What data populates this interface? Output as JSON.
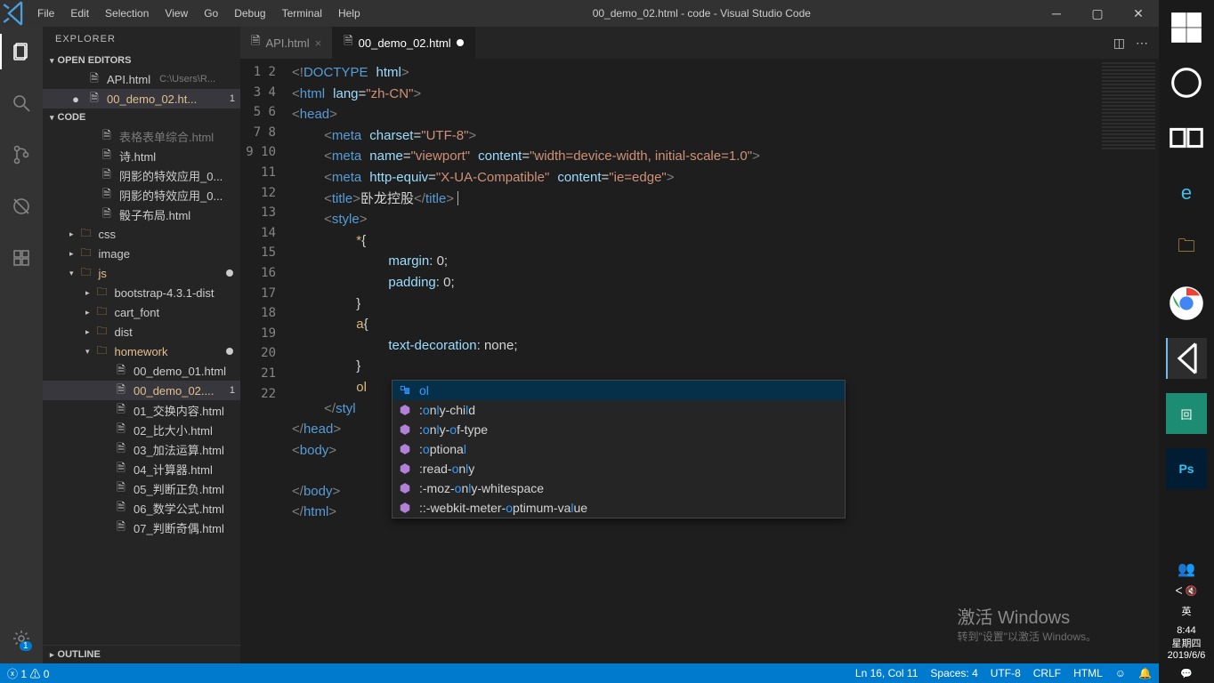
{
  "titlebar": {
    "menu": [
      "File",
      "Edit",
      "Selection",
      "View",
      "Go",
      "Debug",
      "Terminal",
      "Help"
    ],
    "title": "00_demo_02.html - code - Visual Studio Code"
  },
  "activity": {
    "gear_badge": "1"
  },
  "sidebar": {
    "title": "EXPLORER",
    "open_editors_hdr": "OPEN EDITORS",
    "open_editors": [
      {
        "name": "API.html",
        "path": "C:\\Users\\R...",
        "modified": false,
        "active": false
      },
      {
        "name": "00_demo_02.ht...",
        "path": "",
        "badge": "1",
        "modified": true,
        "active": true
      }
    ],
    "code_hdr": "CODE",
    "tree": [
      {
        "indent": 2,
        "type": "file",
        "name": "表格表单综合.html",
        "dim": true
      },
      {
        "indent": 2,
        "type": "file",
        "name": "诗.html"
      },
      {
        "indent": 2,
        "type": "file",
        "name": "阴影的特效应用_0..."
      },
      {
        "indent": 2,
        "type": "file",
        "name": "阴影的特效应用_0..."
      },
      {
        "indent": 2,
        "type": "file",
        "name": "骰子布局.html"
      },
      {
        "indent": 1,
        "type": "folder",
        "name": "css",
        "chev": "▸"
      },
      {
        "indent": 1,
        "type": "folder",
        "name": "image",
        "chev": "▸"
      },
      {
        "indent": 1,
        "type": "folder",
        "name": "js",
        "chev": "▾",
        "unsaved": true,
        "dot": true
      },
      {
        "indent": 2,
        "type": "folder",
        "name": "bootstrap-4.3.1-dist",
        "chev": "▸"
      },
      {
        "indent": 2,
        "type": "folder",
        "name": "cart_font",
        "chev": "▸"
      },
      {
        "indent": 2,
        "type": "folder",
        "name": "dist",
        "chev": "▸"
      },
      {
        "indent": 2,
        "type": "folder",
        "name": "homework",
        "chev": "▾",
        "unsaved": true,
        "dot": true
      },
      {
        "indent": 3,
        "type": "file",
        "name": "00_demo_01.html"
      },
      {
        "indent": 3,
        "type": "file",
        "name": "00_demo_02....",
        "unsaved": true,
        "active": true,
        "badge": "1"
      },
      {
        "indent": 3,
        "type": "file",
        "name": "01_交换内容.html"
      },
      {
        "indent": 3,
        "type": "file",
        "name": "02_比大小.html"
      },
      {
        "indent": 3,
        "type": "file",
        "name": "03_加法运算.html"
      },
      {
        "indent": 3,
        "type": "file",
        "name": "04_计算器.html"
      },
      {
        "indent": 3,
        "type": "file",
        "name": "05_判断正负.html"
      },
      {
        "indent": 3,
        "type": "file",
        "name": "06_数学公式.html"
      },
      {
        "indent": 3,
        "type": "file",
        "name": "07_判断奇偶.html"
      }
    ],
    "outline_hdr": "OUTLINE"
  },
  "tabs": [
    {
      "name": "API.html",
      "active": false,
      "modified": false
    },
    {
      "name": "00_demo_02.html",
      "active": true,
      "modified": true
    }
  ],
  "gutter_start": 1,
  "gutter_end": 22,
  "code_html": "<span class='pnk'>&lt;!</span><span class='tag'>DOCTYPE</span> <span class='attr'>html</span><span class='pnk'>&gt;</span>\n<span class='pnk'>&lt;</span><span class='tag'>html</span> <span class='attr'>lang</span><span class='txt'>=</span><span class='str'>\"zh-CN\"</span><span class='pnk'>&gt;</span>\n<span class='pnk'>&lt;</span><span class='tag'>head</span><span class='pnk'>&gt;</span>\n    <span class='pnk'>&lt;</span><span class='tag'>meta</span> <span class='attr'>charset</span><span class='txt'>=</span><span class='str'>\"UTF-8\"</span><span class='pnk'>&gt;</span>\n    <span class='pnk'>&lt;</span><span class='tag'>meta</span> <span class='attr'>name</span><span class='txt'>=</span><span class='str'>\"viewport\"</span> <span class='attr'>content</span><span class='txt'>=</span><span class='str'>\"width=device-width, initial-scale=1.0\"</span><span class='pnk'>&gt;</span>\n    <span class='pnk'>&lt;</span><span class='tag'>meta</span> <span class='attr'>http-equiv</span><span class='txt'>=</span><span class='str'>\"X-UA-Compatible\"</span> <span class='attr'>content</span><span class='txt'>=</span><span class='str'>\"ie=edge\"</span><span class='pnk'>&gt;</span>\n    <span class='pnk'>&lt;</span><span class='tag'>title</span><span class='pnk'>&gt;</span><span class='txt'>卧龙控股</span><span class='pnk'>&lt;/</span><span class='tag'>title</span><span class='pnk'>&gt;</span><span class='cursor'></span>\n    <span class='pnk'>&lt;</span><span class='tag'>style</span><span class='pnk'>&gt;</span>\n        <span class='sel'>*</span><span class='txt'>{</span>\n            <span class='attr'>margin</span><span class='txt'>: 0;</span>\n            <span class='attr'>padding</span><span class='txt'>: 0;</span>\n        <span class='txt'>}</span>\n        <span class='sel'>a</span><span class='txt'>{</span>\n            <span class='attr'>text-decoration</span><span class='txt'>: none;</span>\n        <span class='txt'>}</span>\n        <span class='sel'>ol</span>\n    <span class='pnk'>&lt;/</span><span class='tag'>styl</span>\n<span class='pnk'>&lt;/</span><span class='tag'>head</span><span class='pnk'>&gt;</span>\n<span class='pnk'>&lt;</span><span class='tag'>body</span><span class='pnk'>&gt;</span>\n    \n<span class='pnk'>&lt;/</span><span class='tag'>body</span><span class='pnk'>&gt;</span>\n<span class='pnk'>&lt;/</span><span class='tag'>html</span><span class='pnk'>&gt;</span>",
  "autocomplete": {
    "items": [
      {
        "text": "ol",
        "hl_parts": [
          "",
          "ol",
          ""
        ]
      },
      {
        "text": ":only-child",
        "hl_parts": [
          ":",
          "o",
          "n",
          "l",
          "y-chi",
          "l",
          "d"
        ]
      },
      {
        "text": ":only-of-type",
        "hl_parts": [
          ":",
          "o",
          "n",
          "l",
          "y-",
          "o",
          "f-type"
        ]
      },
      {
        "text": ":optional",
        "hl_parts": [
          ":",
          "o",
          "ptiona",
          "l",
          ""
        ]
      },
      {
        "text": ":read-only",
        "hl_parts": [
          ":read-",
          "o",
          "n",
          "l",
          "y"
        ]
      },
      {
        "text": ":-moz-only-whitespace",
        "hl_parts": [
          ":-moz-",
          "o",
          "n",
          "l",
          "y-whitespace"
        ]
      },
      {
        "text": "::-webkit-meter-optimum-value",
        "hl_parts": [
          "::-webkit-meter-",
          "o",
          "ptimum-va",
          "l",
          "ue"
        ]
      }
    ]
  },
  "statusbar": {
    "errors": "1",
    "warnings": "0",
    "ln_col": "Ln 16, Col 11",
    "spaces": "Spaces: 4",
    "encoding": "UTF-8",
    "eol": "CRLF",
    "lang": "HTML"
  },
  "watermark": {
    "l1": "激活 Windows",
    "l2": "转到\"设置\"以激活 Windows。"
  },
  "winpanel": {
    "clock": "8:44",
    "weekday": "星期四",
    "date": "2019/6/6",
    "ime": "英"
  }
}
